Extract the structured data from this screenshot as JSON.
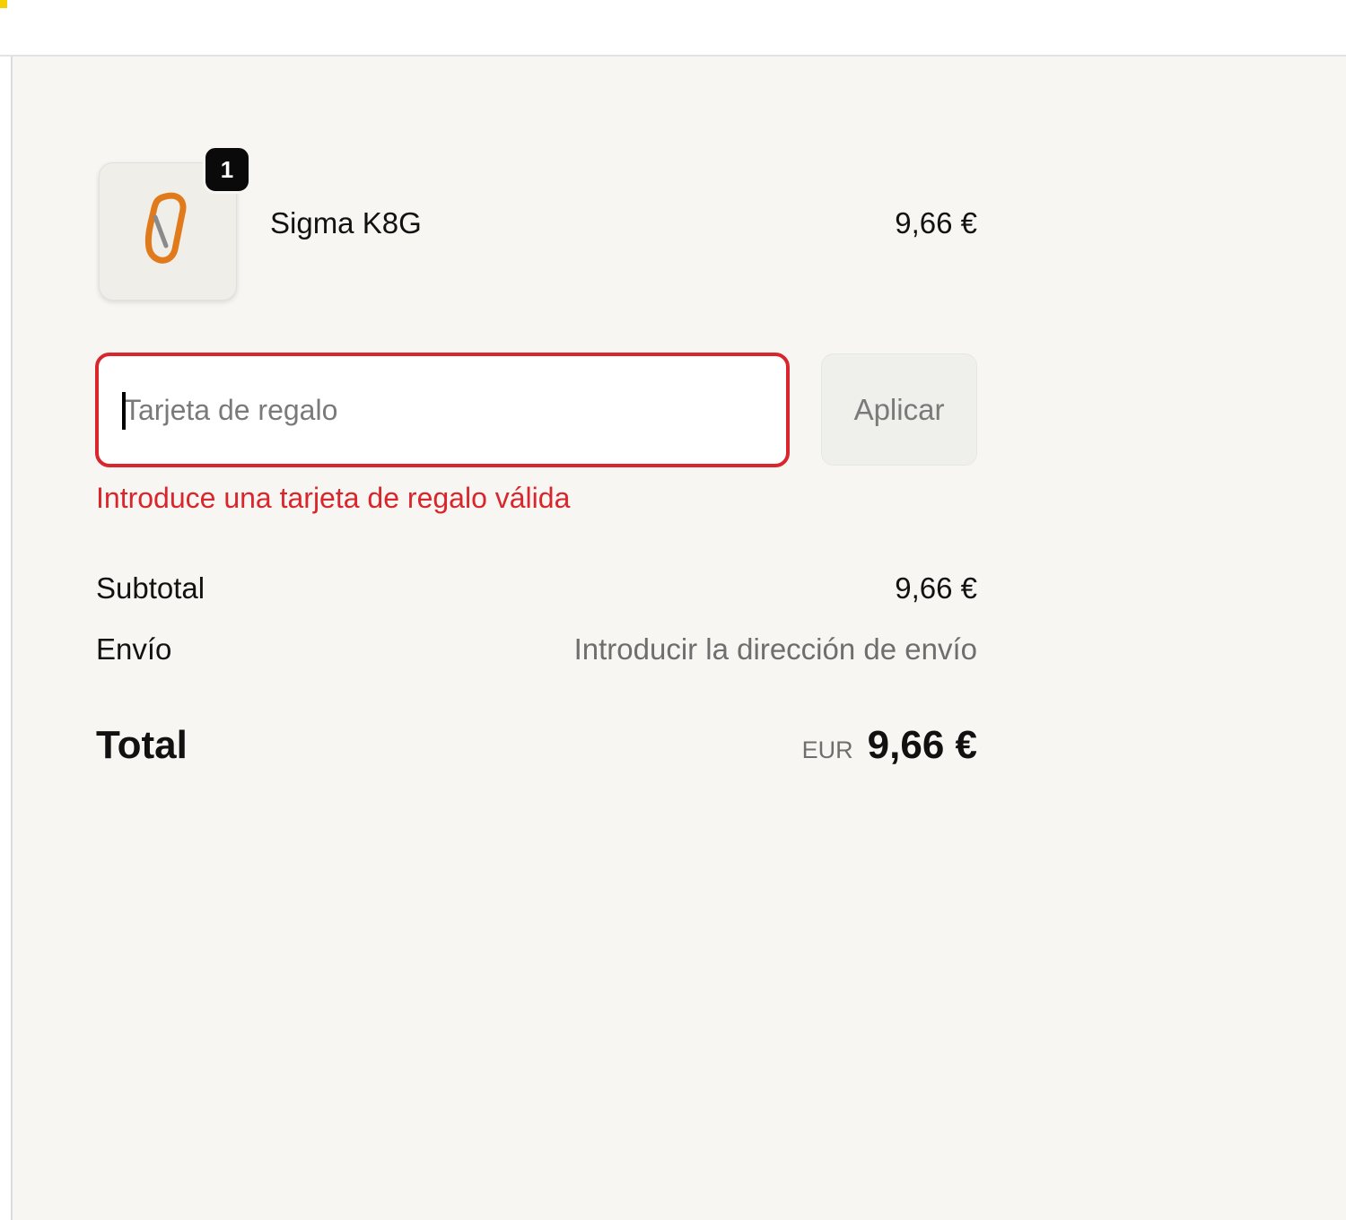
{
  "colors": {
    "panel_bg": "#f7f6f2",
    "error": "#d9262c",
    "accent": "#f5d000",
    "badge_bg": "#0a0a0a",
    "product_icon": "#e07a1a"
  },
  "icons": {
    "product": "carabiner-icon"
  },
  "cart": {
    "items": [
      {
        "quantity": "1",
        "name": "Sigma K8G",
        "price": "9,66 €"
      }
    ]
  },
  "gift_card": {
    "placeholder": "Tarjeta de regalo",
    "value": "",
    "apply_label": "Aplicar",
    "error": "Introduce una tarjeta de regalo válida"
  },
  "summary": {
    "subtotal_label": "Subtotal",
    "subtotal_value": "9,66 €",
    "shipping_label": "Envío",
    "shipping_value": "Introducir la dirección de envío",
    "total_label": "Total",
    "currency_code": "EUR",
    "total_value": "9,66 €"
  }
}
